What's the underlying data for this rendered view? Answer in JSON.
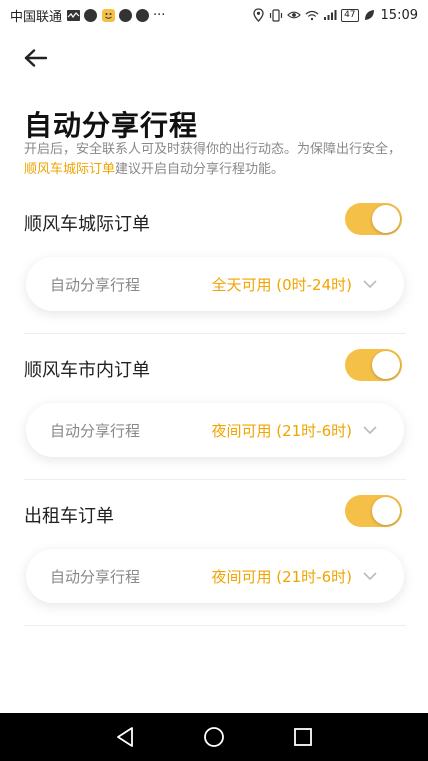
{
  "status_bar": {
    "carrier": "中国联通",
    "more": "···",
    "battery": "47",
    "time": "15:09"
  },
  "header": {
    "title": "自动分享行程",
    "desc_prefix": "开启后，安全联系人可及时获得你的出行动态。为保障出行安全，",
    "desc_link": "顺风车城际订单",
    "desc_suffix": "建议开启自动分享行程功能。"
  },
  "sections": [
    {
      "title": "顺风车城际订单",
      "enabled": true,
      "row_label": "自动分享行程",
      "row_value": "全天可用 (0时-24时)"
    },
    {
      "title": "顺风车市内订单",
      "enabled": true,
      "row_label": "自动分享行程",
      "row_value": "夜间可用 (21时-6时)"
    },
    {
      "title": "出租车订单",
      "enabled": true,
      "row_label": "自动分享行程",
      "row_value": "夜间可用 (21时-6时)"
    }
  ],
  "colors": {
    "accent": "#f0a500",
    "toggle_on": "#f5c048"
  }
}
